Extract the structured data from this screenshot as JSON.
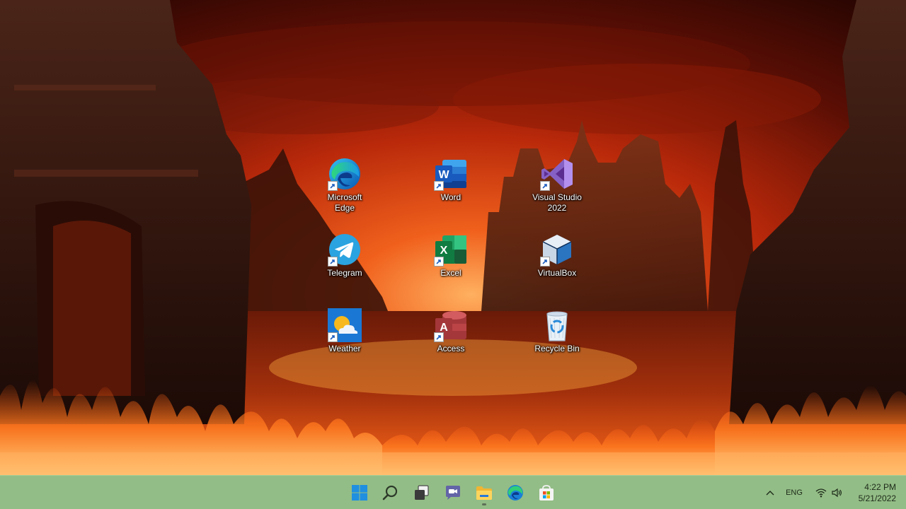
{
  "desktop": {
    "icons": [
      {
        "name": "microsoft-edge",
        "label": "Microsoft\nEdge",
        "icon": "edge-icon"
      },
      {
        "name": "word",
        "label": "Word",
        "icon": "word-icon"
      },
      {
        "name": "visual-studio",
        "label": "Visual Studio\n2022",
        "icon": "visual-studio-icon"
      },
      {
        "name": "telegram",
        "label": "Telegram",
        "icon": "telegram-icon"
      },
      {
        "name": "excel",
        "label": "Excel",
        "icon": "excel-icon"
      },
      {
        "name": "virtualbox",
        "label": "VirtualBox",
        "icon": "virtualbox-icon"
      },
      {
        "name": "weather",
        "label": "Weather",
        "icon": "weather-icon"
      },
      {
        "name": "access",
        "label": "Access",
        "icon": "access-icon"
      },
      {
        "name": "recycle-bin",
        "label": "Recycle Bin",
        "icon": "recycle-bin-icon"
      }
    ]
  },
  "taskbar": {
    "apps": [
      "start-icon",
      "search-icon",
      "task-view-icon",
      "teams-chat-icon",
      "file-explorer-icon",
      "edge-icon",
      "microsoft-store-icon"
    ],
    "active_app": "file-explorer-icon",
    "tray": {
      "chevron": "chevron-up-icon",
      "language": "ENG",
      "wifi": "wifi-icon",
      "volume": "volume-icon"
    },
    "clock": {
      "time": "4:22 PM",
      "date": "5/21/2022"
    }
  },
  "colors": {
    "taskbar": "#93bd86",
    "sky": "#c8320e",
    "fire": "#ff7a1a"
  }
}
